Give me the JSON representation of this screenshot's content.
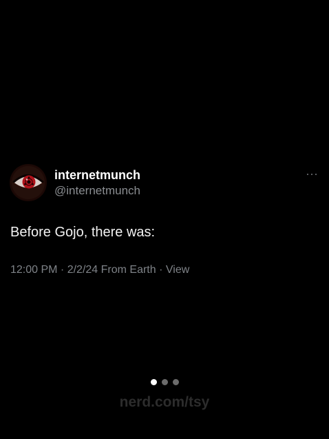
{
  "tweet": {
    "display_name": "internetmunch",
    "handle": "@internetmunch",
    "text": "Before Gojo, there was:",
    "meta": {
      "time": "12:00 PM",
      "separator1": " · ",
      "date": "2/2/24",
      "location": " From Earth",
      "separator2": " · ",
      "view_label": "View"
    },
    "more_icon": "more-horizontal-icon",
    "avatar_icon": "sharingan-eye-avatar"
  },
  "carousel": {
    "pages": 3,
    "active_index": 0,
    "active_color": "#ffffff",
    "inactive_color": "#6b6b6b"
  },
  "watermark": {
    "text": "nerd.com/tsy"
  },
  "colors": {
    "background": "#000000",
    "primary_text": "#ffffff",
    "secondary_text": "#8b8e92",
    "eye_red": "#b0121a"
  }
}
